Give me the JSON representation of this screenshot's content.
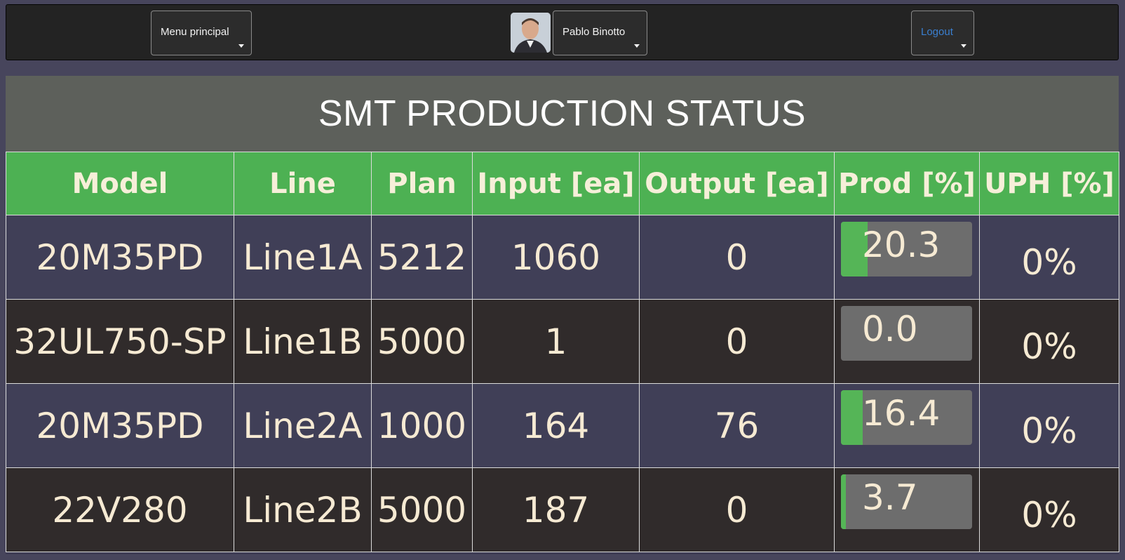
{
  "topbar": {
    "menu_label": "Menu principal",
    "user_name": "Pablo Binotto",
    "logout_label": "Logout"
  },
  "panel": {
    "title": "SMT PRODUCTION STATUS"
  },
  "table": {
    "headers": [
      "Model",
      "Line",
      "Plan",
      "Input [ea]",
      "Output [ea]",
      "Prod [%]",
      "UPH [%]"
    ],
    "rows": [
      {
        "model": "20M35PD",
        "line": "Line1A",
        "plan": "5212",
        "input": "1060",
        "output": "0",
        "prod": "20.3",
        "uph": "0%"
      },
      {
        "model": "32UL750-SP",
        "line": "Line1B",
        "plan": "5000",
        "input": "1",
        "output": "0",
        "prod": "0.0",
        "uph": "0%"
      },
      {
        "model": "20M35PD",
        "line": "Line2A",
        "plan": "1000",
        "input": "164",
        "output": "76",
        "prod": "16.4",
        "uph": "0%"
      },
      {
        "model": "22V280",
        "line": "Line2B",
        "plan": "5000",
        "input": "187",
        "output": "0",
        "prod": "3.7",
        "uph": "0%"
      }
    ]
  },
  "colors": {
    "header_green": "#4db153",
    "prod_fill": "#55b557",
    "row_odd": "#403f57",
    "row_even": "#302b2b"
  }
}
